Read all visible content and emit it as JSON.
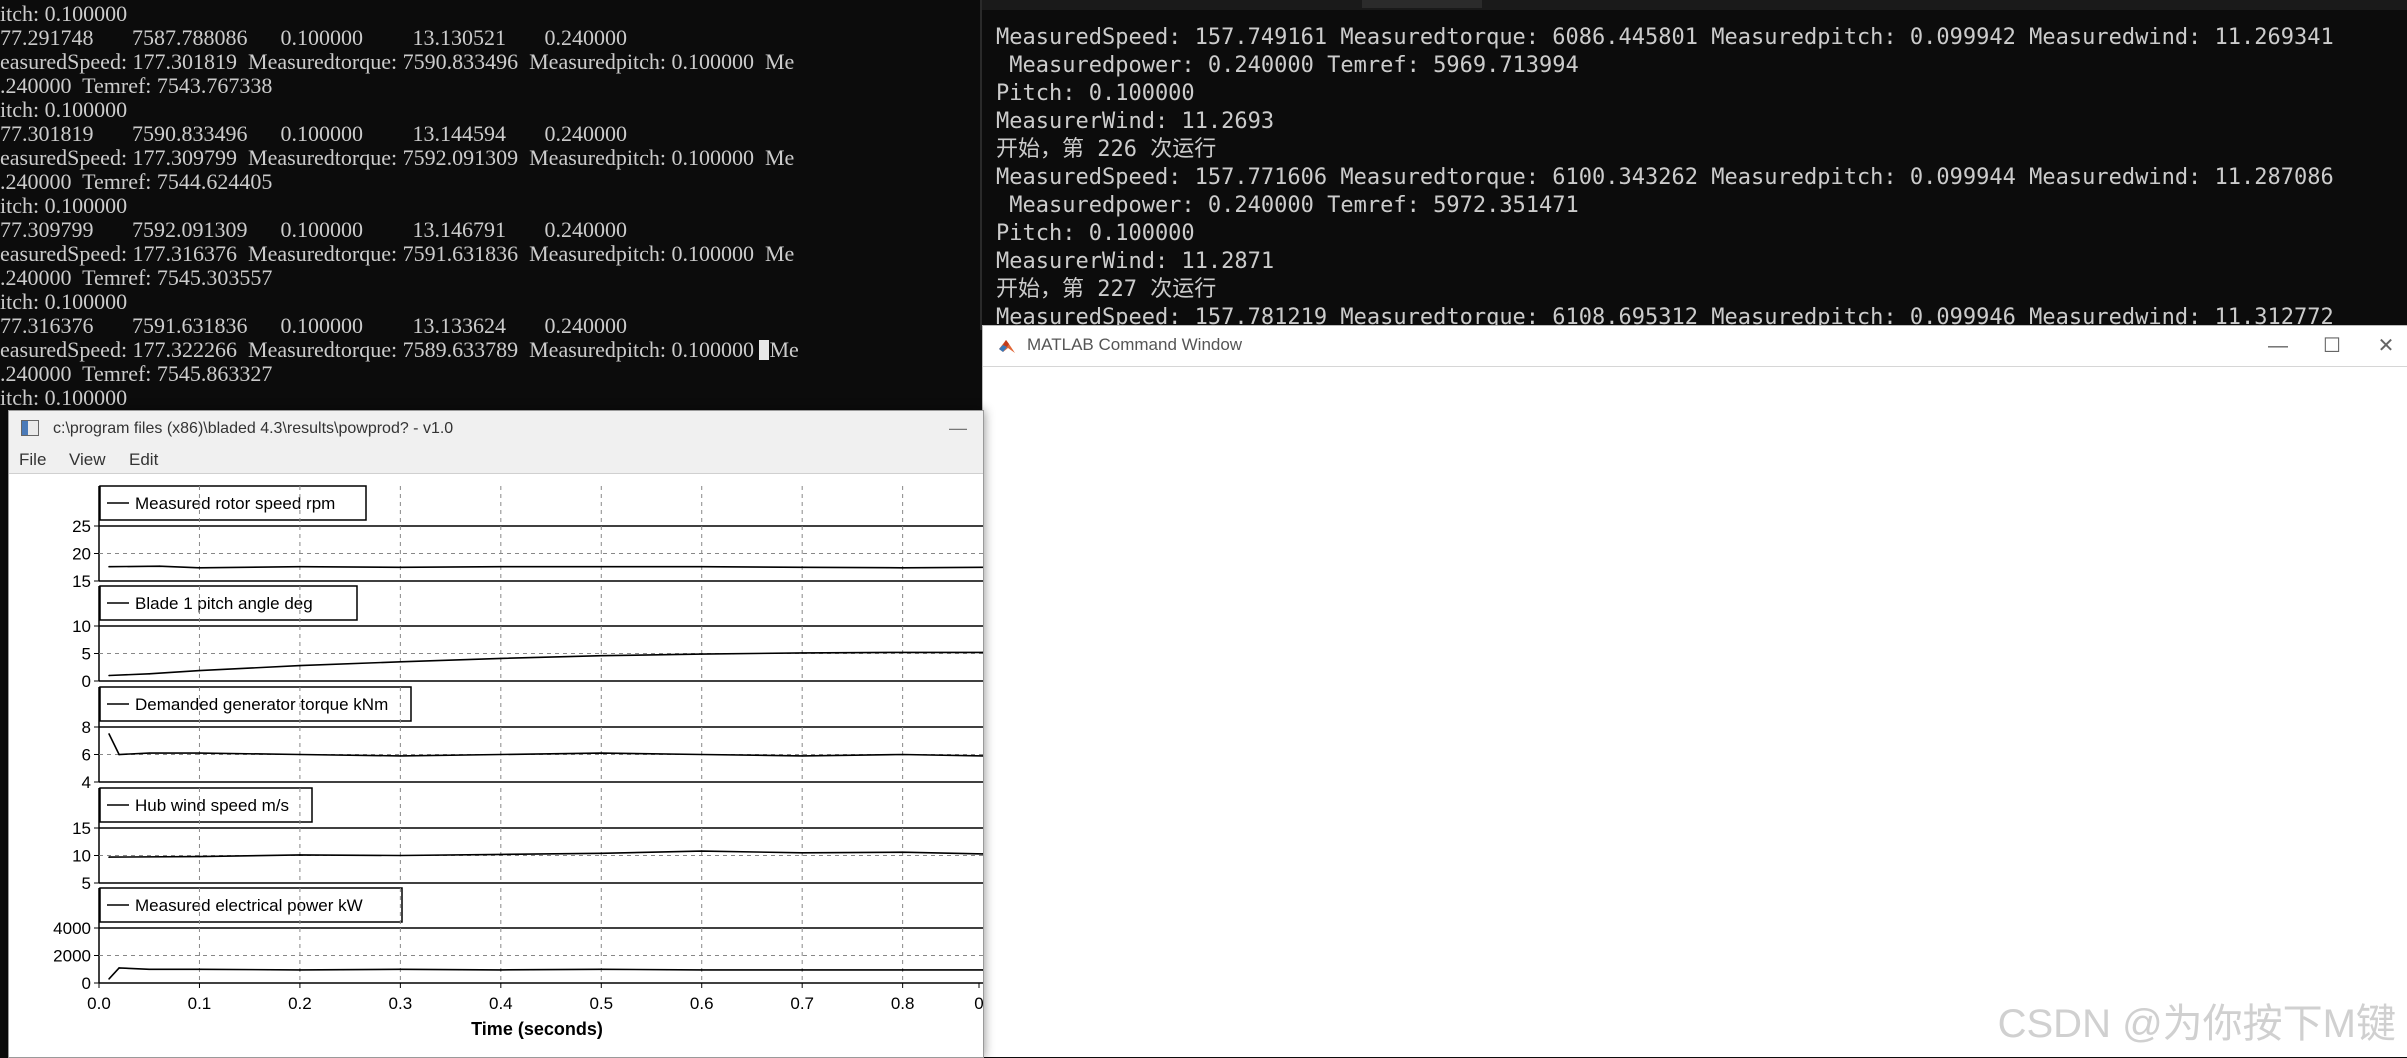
{
  "left_console": {
    "lines": [
      "itch: 0.100000",
      "77.291748       7587.788086      0.100000         13.130521       0.240000",
      "easuredSpeed: 177.301819  Measuredtorque: 7590.833496  Measuredpitch: 0.100000  Me",
      ".240000  Temref: 7543.767338",
      "itch: 0.100000",
      "77.301819       7590.833496      0.100000         13.144594       0.240000",
      "easuredSpeed: 177.309799  Measuredtorque: 7592.091309  Measuredpitch: 0.100000  Me",
      ".240000  Temref: 7544.624405",
      "itch: 0.100000",
      "77.309799       7592.091309      0.100000         13.146791       0.240000",
      "easuredSpeed: 177.316376  Measuredtorque: 7591.631836  Measuredpitch: 0.100000  Me",
      ".240000  Temref: 7545.303557",
      "itch: 0.100000",
      "77.316376       7591.631836      0.100000         13.133624       0.240000",
      "easuredSpeed: 177.322266  Measuredtorque: 7589.633789  Measuredpitch: 0.100000 ",
      ".240000  Temref: 7545.863327",
      "itch: 0.100000"
    ],
    "cursor_suffix": "Me"
  },
  "right_console": {
    "lines": [
      "MeasuredSpeed: 157.749161 Measuredtorque: 6086.445801 Measuredpitch: 0.099942 Measuredwind: 11.269341",
      " Measuredpower: 0.240000 Temref: 5969.713994",
      "Pitch: 0.100000",
      "MeasurerWind: 11.2693",
      "开始，第 226 次运行",
      "MeasuredSpeed: 157.771606 Measuredtorque: 6100.343262 Measuredpitch: 0.099944 Measuredwind: 11.287086",
      " Measuredpower: 0.240000 Temref: 5972.351471",
      "Pitch: 0.100000",
      "MeasurerWind: 11.2871",
      "开始，第 227 次运行",
      "MeasuredSpeed: 157.781219 Measuredtorque: 6108.695312 Measuredpitch: 0.099946 Measuredwind: 11.312772"
    ]
  },
  "matlab_window": {
    "title": "MATLAB Command Window",
    "minimize_glyph": "—",
    "maximize_glyph": "☐",
    "close_glyph": "✕"
  },
  "bladed_window": {
    "title": "c:\\program files (x86)\\bladed 4.3\\results\\powprod? - v1.0",
    "minimize_glyph": "—",
    "menu": [
      "File",
      "View",
      "Edit"
    ]
  },
  "watermark": "CSDN @为你按下M键",
  "chart_data": {
    "type": "line",
    "xlabel": "Time (seconds)",
    "xlim": [
      0,
      0.88
    ],
    "x_ticks": [
      "0.0",
      "0.1",
      "0.2",
      "0.3",
      "0.4",
      "0.5",
      "0.6",
      "0.7",
      "0.8",
      "0"
    ],
    "panels": [
      {
        "name": "Measured rotor speed rpm",
        "ylim": [
          15,
          25
        ],
        "y_ticks": [
          "25",
          "20",
          "15"
        ],
        "grid_y": [
          20
        ],
        "x": [
          0.01,
          0.06,
          0.1,
          0.2,
          0.3,
          0.4,
          0.5,
          0.6,
          0.7,
          0.8,
          0.88
        ],
        "y": [
          17.6,
          17.7,
          17.4,
          17.6,
          17.5,
          17.6,
          17.6,
          17.6,
          17.5,
          17.4,
          17.5
        ]
      },
      {
        "name": "Blade 1 pitch angle deg",
        "ylim": [
          0,
          10
        ],
        "y_ticks": [
          "10",
          "5",
          "0"
        ],
        "grid_y": [
          5
        ],
        "x": [
          0.01,
          0.05,
          0.1,
          0.2,
          0.3,
          0.4,
          0.5,
          0.6,
          0.7,
          0.8,
          0.88
        ],
        "y": [
          1.0,
          1.3,
          1.9,
          2.8,
          3.5,
          4.1,
          4.6,
          4.9,
          5.1,
          5.2,
          5.2
        ]
      },
      {
        "name": "Demanded generator torque kNm",
        "ylim": [
          4,
          8
        ],
        "y_ticks": [
          "8",
          "6",
          "4"
        ],
        "grid_y": [
          6
        ],
        "x": [
          0.01,
          0.02,
          0.05,
          0.1,
          0.2,
          0.3,
          0.4,
          0.5,
          0.6,
          0.7,
          0.8,
          0.88
        ],
        "y": [
          7.5,
          6.0,
          6.1,
          6.1,
          6.0,
          5.9,
          6.0,
          6.1,
          6.0,
          5.9,
          6.0,
          5.9
        ]
      },
      {
        "name": "Hub wind speed m/s",
        "ylim": [
          5,
          15
        ],
        "y_ticks": [
          "15",
          "10",
          "5"
        ],
        "grid_y": [
          10
        ],
        "x": [
          0.01,
          0.1,
          0.2,
          0.3,
          0.4,
          0.5,
          0.6,
          0.7,
          0.8,
          0.88
        ],
        "y": [
          9.7,
          9.8,
          10.1,
          10.0,
          10.2,
          10.4,
          10.8,
          10.5,
          10.6,
          10.3
        ]
      },
      {
        "name": "Measured electrical power kW",
        "ylim": [
          0,
          4000
        ],
        "y_ticks": [
          "4000",
          "2000",
          "0"
        ],
        "grid_y": [
          2000
        ],
        "x": [
          0.01,
          0.02,
          0.05,
          0.1,
          0.2,
          0.3,
          0.4,
          0.5,
          0.6,
          0.7,
          0.8,
          0.88
        ],
        "y": [
          300,
          1100,
          1000,
          1000,
          950,
          1000,
          950,
          1000,
          950,
          950,
          950,
          950
        ]
      }
    ]
  }
}
